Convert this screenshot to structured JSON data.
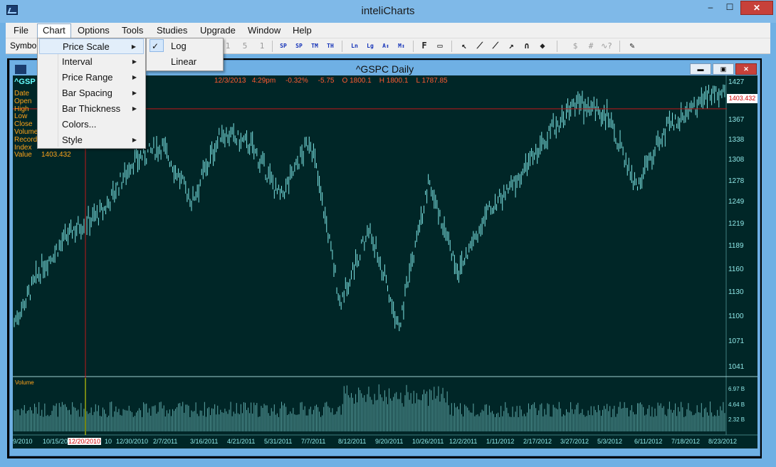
{
  "app": {
    "title": "inteliCharts",
    "window_buttons": {
      "minimize": "‒",
      "maximize": "☐",
      "close": "✕"
    }
  },
  "menubar": {
    "items": [
      "File",
      "Chart",
      "Options",
      "Tools",
      "Studies",
      "Upgrade",
      "Window",
      "Help"
    ]
  },
  "toolbar": {
    "symbol_label": "Symbol",
    "icons": [
      {
        "name": "sp-left-icon",
        "glyph": "SP"
      },
      {
        "name": "sp-right-icon",
        "glyph": "SP"
      },
      {
        "name": "tm-icon",
        "glyph": "TM"
      },
      {
        "name": "th-icon",
        "glyph": "TH"
      },
      {
        "name": "ln-scale-icon",
        "glyph": "Ln"
      },
      {
        "name": "lg-scale-icon",
        "glyph": "Lg"
      },
      {
        "name": "a-scale-icon",
        "glyph": "A↕"
      },
      {
        "name": "m-scale-icon",
        "glyph": "M↕"
      },
      {
        "name": "f-button-icon",
        "glyph": "F"
      },
      {
        "name": "eraser-box-icon",
        "glyph": "▭"
      },
      {
        "name": "pointer-icon",
        "glyph": "↖"
      },
      {
        "name": "line-tool-icon",
        "glyph": "⟋"
      },
      {
        "name": "ray-tool-icon",
        "glyph": "⟋"
      },
      {
        "name": "arrow-tool-icon",
        "glyph": "↗"
      },
      {
        "name": "magnet-icon",
        "glyph": "∩"
      },
      {
        "name": "eraser-icon",
        "glyph": "◆"
      },
      {
        "name": "dollar-icon",
        "glyph": "$"
      },
      {
        "name": "hash-icon",
        "glyph": "#"
      },
      {
        "name": "wave-icon",
        "glyph": "∿?"
      },
      {
        "name": "edit-note-icon",
        "glyph": "✎"
      }
    ],
    "faded_digits": [
      "1",
      "5",
      "1"
    ]
  },
  "chart_window": {
    "title": "^GSPC Daily",
    "buttons": {
      "minimize": "▬",
      "maximize": "▣",
      "close": "✕"
    }
  },
  "chart_header": {
    "ticker": "^GSP",
    "quote_line": "12/3/2013   4:29pm     -0.32%     -5.75    O 1800.1    H 1800.1    L 1787.85"
  },
  "info_panel": {
    "labels": [
      "Date",
      "Open",
      "High",
      "Low",
      "Close",
      "Volume",
      "Record",
      "Index",
      "Value"
    ],
    "values": {
      "Index": "",
      "Value": "1403.432"
    }
  },
  "price_axis": {
    "ticks": [
      "1427",
      "1367",
      "1338",
      "1308",
      "1278",
      "1249",
      "1219",
      "1189",
      "1160",
      "1130",
      "1100",
      "1071",
      "1041"
    ],
    "cursor_value": "1403.432"
  },
  "volume_axis": {
    "label": "Volume",
    "ticks": [
      "6.97 B",
      "4.64 B",
      "2.32 B"
    ]
  },
  "date_axis": {
    "labels": [
      "9/2010",
      "10/15/20",
      "12/20/2010",
      "10",
      "12/30/2010",
      "2/7/2011",
      "3/16/2011",
      "4/21/2011",
      "5/31/2011",
      "7/7/2011",
      "8/12/2011",
      "9/20/2011",
      "10/26/2011",
      "12/2/2011",
      "1/11/2012",
      "2/17/2012",
      "3/27/2012",
      "5/3/2012",
      "6/11/2012",
      "7/18/2012",
      "8/23/2012"
    ],
    "highlighted": "12/20/2010"
  },
  "chart_menu": {
    "items": [
      {
        "label": "Price Scale",
        "submenu": true
      },
      {
        "label": "Interval",
        "submenu": true
      },
      {
        "label": "Price Range",
        "submenu": true
      },
      {
        "label": "Bar Spacing",
        "submenu": true
      },
      {
        "label": "Bar Thickness",
        "submenu": true
      },
      {
        "label": "Colors...",
        "submenu": false
      },
      {
        "label": "Style",
        "submenu": true
      }
    ]
  },
  "price_scale_submenu": {
    "items": [
      {
        "label": "Log",
        "checked": true
      },
      {
        "label": "Linear",
        "checked": false
      }
    ]
  },
  "chart_data": {
    "type": "ohlc",
    "title": "^GSPC Daily",
    "ticker": "^GSPC",
    "scale": "log",
    "ylim": [
      1030,
      1435
    ],
    "x_range": [
      "9/2010",
      "8/2012"
    ],
    "price_keypoints": [
      {
        "date": "9/2010",
        "price": 1095
      },
      {
        "date": "10/15/2010",
        "price": 1170
      },
      {
        "date": "11/5/2010",
        "price": 1220
      },
      {
        "date": "12/20/2010",
        "price": 1245
      },
      {
        "date": "2/7/2011",
        "price": 1320
      },
      {
        "date": "2/18/2011",
        "price": 1345
      },
      {
        "date": "3/16/2011",
        "price": 1260
      },
      {
        "date": "4/29/2011",
        "price": 1365
      },
      {
        "date": "5/31/2011",
        "price": 1345
      },
      {
        "date": "6/16/2011",
        "price": 1265
      },
      {
        "date": "7/7/2011",
        "price": 1355
      },
      {
        "date": "8/8/2011",
        "price": 1120
      },
      {
        "date": "8/31/2011",
        "price": 1220
      },
      {
        "date": "10/3/2011",
        "price": 1085
      },
      {
        "date": "10/27/2011",
        "price": 1285
      },
      {
        "date": "11/25/2011",
        "price": 1160
      },
      {
        "date": "12/2/2011",
        "price": 1245
      },
      {
        "date": "1/11/2012",
        "price": 1290
      },
      {
        "date": "2/17/2012",
        "price": 1360
      },
      {
        "date": "4/2/2012",
        "price": 1415
      },
      {
        "date": "5/3/2012",
        "price": 1395
      },
      {
        "date": "6/4/2012",
        "price": 1280
      },
      {
        "date": "7/18/2012",
        "price": 1370
      },
      {
        "date": "8/23/2012",
        "price": 1410
      },
      {
        "date": "9/14/2012",
        "price": 1440
      }
    ],
    "volume_range_b": [
      0,
      7.5
    ],
    "cursor": {
      "date": "12/20/2010",
      "value": 1403.432
    }
  },
  "colors": {
    "plot_bg": "#002627",
    "bars": "#7fe6e6",
    "volume": "#5fa8a8",
    "cursor": "#c01818",
    "axis_text": "#8fe8e8",
    "info_text": "#ffa31a"
  }
}
